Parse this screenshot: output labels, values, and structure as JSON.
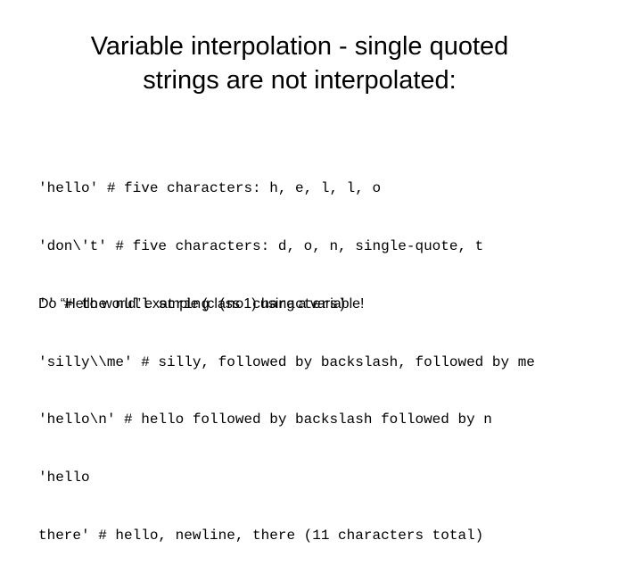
{
  "slide": {
    "title_line1": "Variable interpolation - single quoted",
    "title_line2": "strings are not interpolated:",
    "code_lines": [
      "'hello' # five characters: h, e, l, l, o",
      "'don\\'t' # five characters: d, o, n, single-quote, t",
      "'' # the null string (no characters)",
      "'silly\\\\me' # silly, followed by backslash, followed by me",
      "'hello\\n' # hello followed by backslash followed by n",
      "'hello",
      "there' # hello, newline, there (11 characters total)"
    ],
    "task_text": "Do “Hello world” example (class 1) using a variable!"
  }
}
